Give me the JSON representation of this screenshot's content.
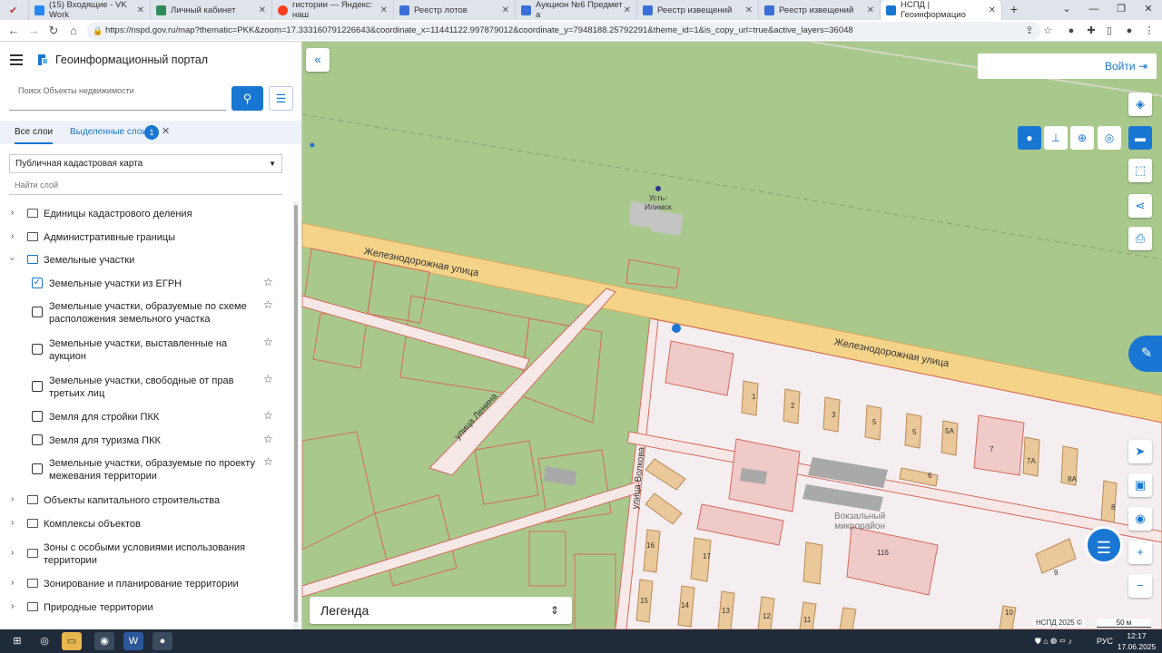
{
  "browser": {
    "tabs": [
      {
        "label": "(15) Входящие - VK Work",
        "color": "#2787f5"
      },
      {
        "label": "Личный кабинет",
        "color": "#2e8b57"
      },
      {
        "label": "гистории — Яндекс: наш",
        "color": "#fc3f1d"
      },
      {
        "label": "Реестр лотов",
        "color": "#3a6fd8"
      },
      {
        "label": "Аукцион №6 Предмет а",
        "color": "#3a6fd8"
      },
      {
        "label": "Реестр извещений",
        "color": "#3a6fd8"
      },
      {
        "label": "Реестр извещений",
        "color": "#3a6fd8"
      },
      {
        "label": "НСПД | Геоинформацио",
        "color": "#1976d2"
      }
    ],
    "url": "https://nspd.gov.ru/map?thematic=PKK&zoom=17.333160791226643&coordinate_x=11441122.997879012&coordinate_y=7948188.25792291&theme_id=1&is_copy_url=true&active_layers=36048"
  },
  "sidebar": {
    "portal_title": "Геоинформационный портал",
    "search_placeholder": "Поиск Объекты недвижимости",
    "tab_all": "Все слои",
    "tab_selected": "Выделенные слои",
    "selected_count": "1",
    "map_select": "Публичная кадастровая карта",
    "find_layer": "Найти слой",
    "tree": {
      "n1": "Единицы кадастрового деления",
      "n2": "Административные границы",
      "n3": "Земельные участки",
      "l1": "Земельные участки из ЕГРН",
      "l2": "Земельные участки, образуемые по схеме расположения земельного участка",
      "l3": "Земельные участки, выставленные на аукцион",
      "l4": "Земельные участки, свободные от прав третьих лиц",
      "l5": "Земля для стройки ПКК",
      "l6": "Земля для туризма ПКК",
      "l7": "Земельные участки, образуемые по проекту межевания территории",
      "n4": "Объекты капитального строительства",
      "n5": "Комплексы объектов",
      "n6": "Зоны с особыми условиями использования территории",
      "n7": "Зонирование и планирование территории",
      "n8": "Природные территории"
    }
  },
  "map": {
    "login": "Войти",
    "legend": "Легенда",
    "copyright": "НСПД 2025 ©",
    "scale": "50 м",
    "labels": {
      "station_line1": "Усть-",
      "station_line2": "Илимск",
      "street_rail_top": "Железнодорожная улица",
      "street_rail_right": "Железнодорожная улица",
      "street_lenina": "улица Ленина",
      "street_volkova": "улица Волкова",
      "district_line1": "Вокзальный",
      "district_line2": "микрорайон"
    },
    "house_numbers": [
      "1",
      "2",
      "3",
      "5",
      "5",
      "5А",
      "7",
      "7А",
      "8А",
      "6",
      "8",
      "16",
      "17",
      "11б",
      "9",
      "15",
      "14",
      "13",
      "12",
      "11",
      "10"
    ]
  },
  "taskbar": {
    "lang": "РУС",
    "time": "12:17",
    "date": "17.06.2025"
  }
}
